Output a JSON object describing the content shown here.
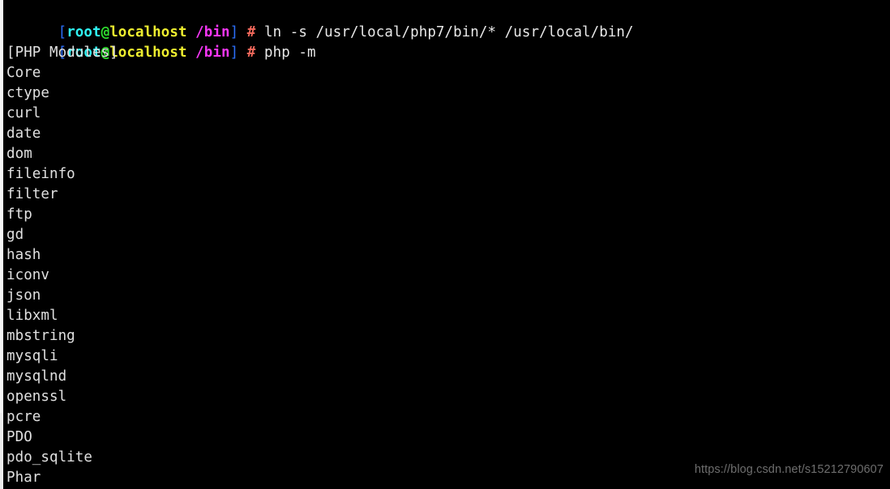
{
  "terminal": {
    "background_color": "#000000",
    "foreground_color": "#e6e6e6",
    "prompt": {
      "open_bracket": "[",
      "user": "root",
      "at": "@",
      "host": "localhost",
      "cwd": "/bin",
      "close_bracket": "]",
      "sigil": "#",
      "colors": {
        "bracket": "#2b6ef7",
        "user": "#2ff3f3",
        "at": "#2fe02f",
        "host": "#eded2f",
        "cwd": "#f236f2",
        "sigil": "#f4695c",
        "command": "#e8e8e8"
      }
    },
    "commands": [
      "ln -s /usr/local/php7/bin/* /usr/local/bin/",
      "php -m"
    ],
    "output_header": "[PHP Modules]",
    "modules": [
      "Core",
      "ctype",
      "curl",
      "date",
      "dom",
      "fileinfo",
      "filter",
      "ftp",
      "gd",
      "hash",
      "iconv",
      "json",
      "libxml",
      "mbstring",
      "mysqli",
      "mysqlnd",
      "openssl",
      "pcre",
      "PDO",
      "pdo_sqlite",
      "Phar"
    ]
  },
  "watermark": {
    "text": "https://blog.csdn.net/s15212790607",
    "color": "#6e6e6e"
  }
}
